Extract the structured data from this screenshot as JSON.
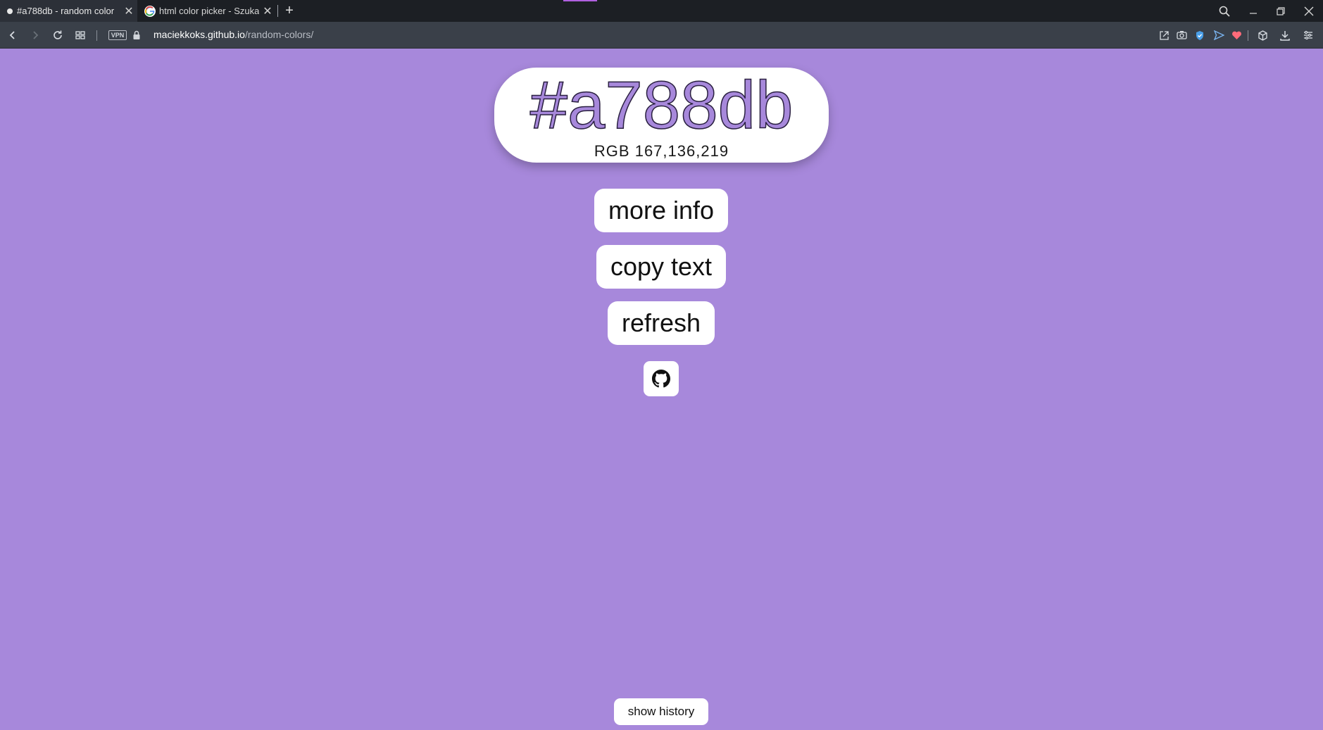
{
  "browser": {
    "tabs": [
      {
        "title": "#a788db - random color",
        "active": true
      },
      {
        "title": "html color picker - Szukaj w",
        "active": false
      }
    ],
    "vpn_label": "VPN",
    "url": {
      "host": "maciekkoks.github.io",
      "path": "/random-colors/"
    }
  },
  "page": {
    "background_color": "#a788db",
    "hex": "#a788db",
    "rgb": "RGB 167,136,219",
    "buttons": {
      "more_info": "more info",
      "copy_text": "copy text",
      "refresh": "refresh",
      "show_history": "show history"
    },
    "github_icon": "github-icon"
  }
}
